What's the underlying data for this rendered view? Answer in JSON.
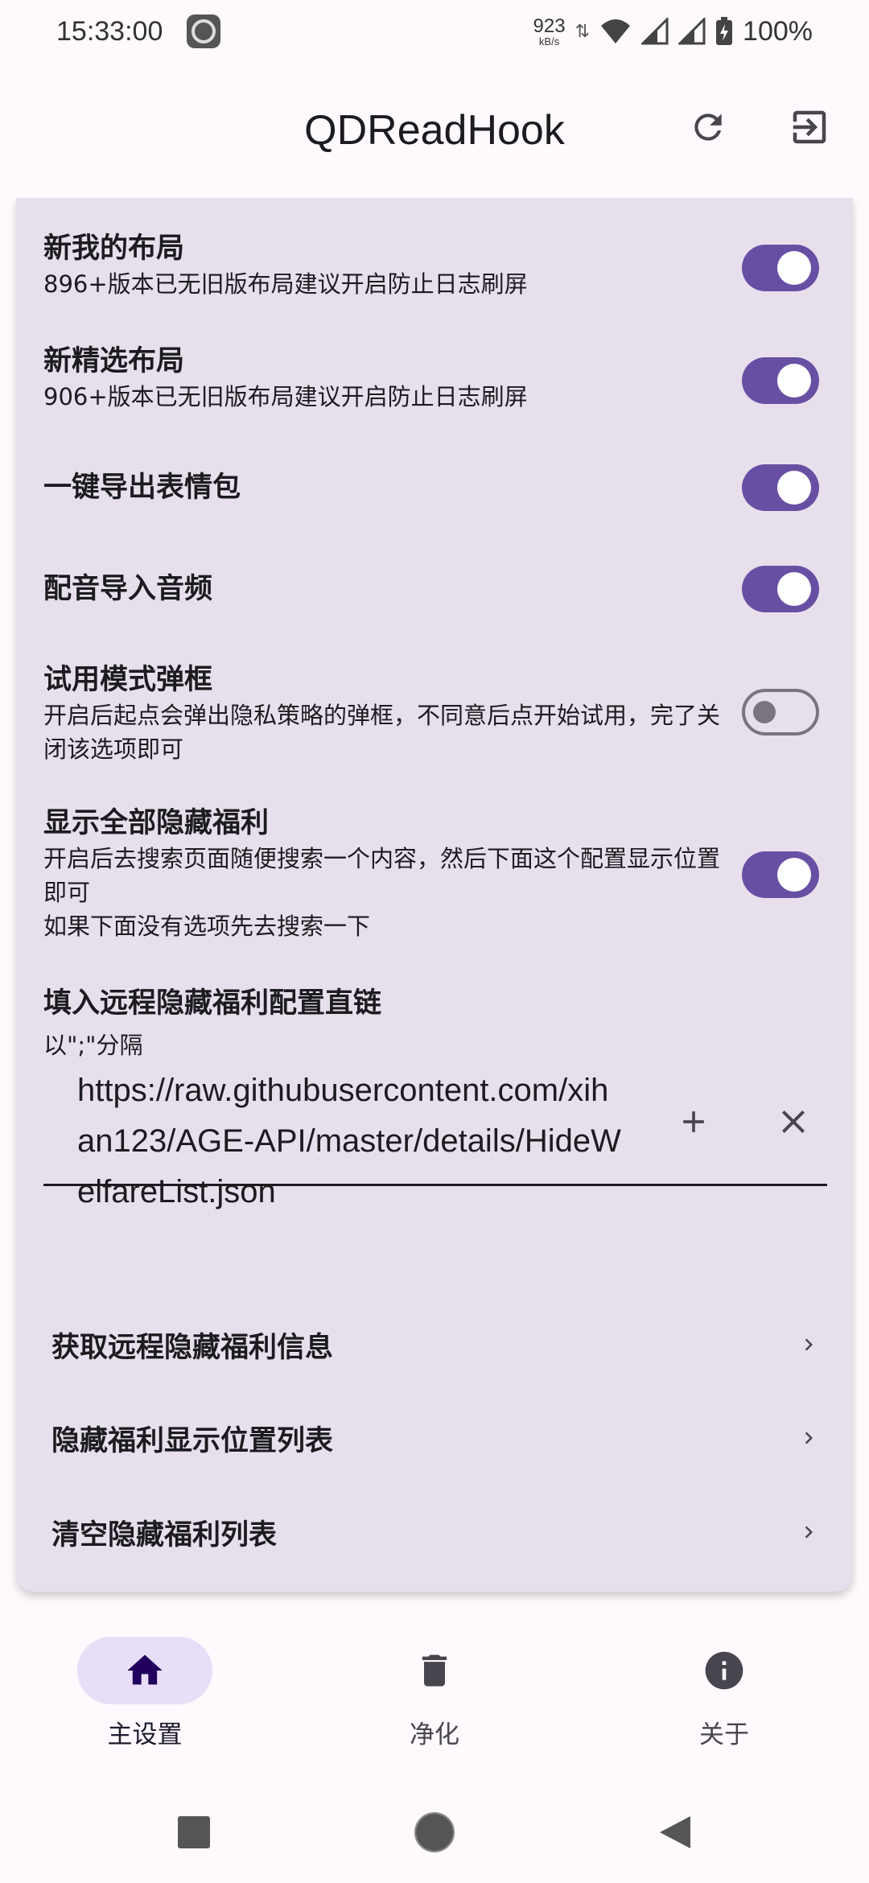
{
  "status_bar": {
    "time": "15:33:00",
    "net_speed": "923",
    "net_unit": "kB/s",
    "battery": "100%"
  },
  "app_bar": {
    "title": "QDReadHook",
    "refresh_icon": "refresh-icon",
    "exit_icon": "exit-icon"
  },
  "settings": [
    {
      "title": "新我的布局",
      "desc": "896+版本已无旧版布局建议开启防止日志刷屏",
      "enabled": true
    },
    {
      "title": "新精选布局",
      "desc": "906+版本已无旧版布局建议开启防止日志刷屏",
      "enabled": true
    },
    {
      "title": "一键导出表情包",
      "desc": "",
      "enabled": true
    },
    {
      "title": "配音导入音频",
      "desc": "",
      "enabled": true
    },
    {
      "title": "试用模式弹框",
      "desc": "开启后起点会弹出隐私策略的弹框，不同意后点开始试用，完了关闭该选项即可",
      "enabled": false
    },
    {
      "title": "显示全部隐藏福利",
      "desc": "开启后去搜索页面随便搜索一个内容，然后下面这个配置显示位置即可\n如果下面没有选项先去搜索一下",
      "enabled": true
    }
  ],
  "remote_config": {
    "title": "填入远程隐藏福利配置直链",
    "desc": "以\";\"分隔",
    "url": "https://raw.githubusercontent.com/xihan123/AGE-API/master/details/HideWelfareList.json"
  },
  "nav_items": [
    {
      "label": "获取远程隐藏福利信息"
    },
    {
      "label": "隐藏福利显示位置列表"
    },
    {
      "label": "清空隐藏福利列表"
    }
  ],
  "bottom_nav": [
    {
      "label": "主设置",
      "icon": "home-icon",
      "active": true
    },
    {
      "label": "净化",
      "icon": "trash-icon",
      "active": false
    },
    {
      "label": "关于",
      "icon": "info-icon",
      "active": false
    }
  ],
  "colors": {
    "accent": "#6750a4",
    "card": "#e7e0ec",
    "background": "#fdf9fd"
  }
}
